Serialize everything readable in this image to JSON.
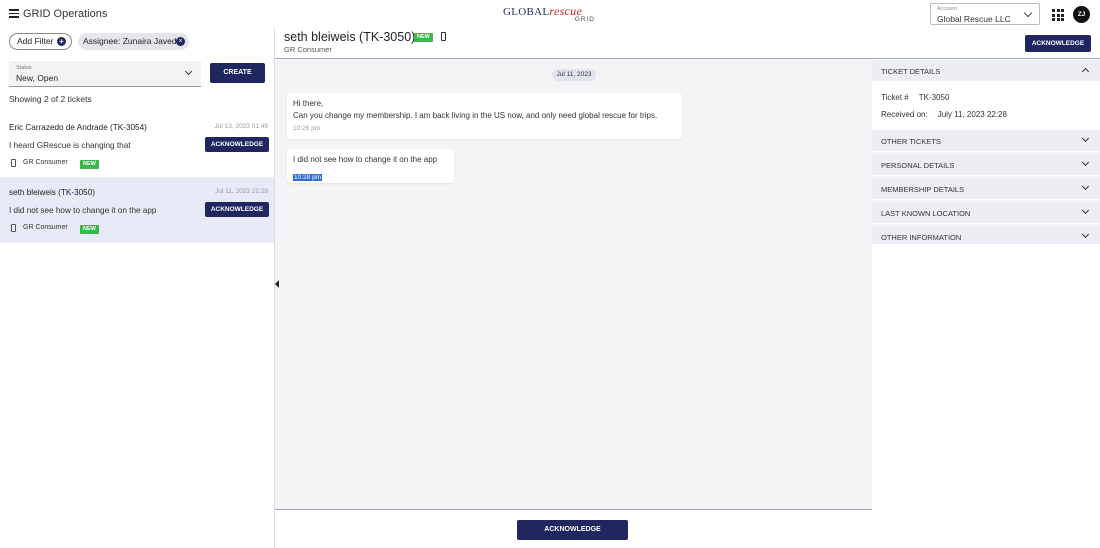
{
  "app": {
    "title": "GRID Operations"
  },
  "logo": {
    "main_left": "GLOBAL",
    "main_right": "rescue",
    "sub": "GRID"
  },
  "account": {
    "label": "Account",
    "value": "Global Rescue LLC"
  },
  "user": {
    "initials": "ZJ"
  },
  "filters": {
    "add_label": "Add Filter",
    "chip_label": "Assignee: Zunaira Javed"
  },
  "status_select": {
    "label": "Status",
    "value": "New, Open"
  },
  "create_label": "CREATE",
  "showing_text": "Showing 2 of 2 tickets",
  "tickets": [
    {
      "name": "Eric Carrazedo de Andrade (TK-3054)",
      "date": "Jul 13, 2023 01:49",
      "message": "I heard GRescue is changing that",
      "button": "ACKNOWLEDGE",
      "source": "GR Consumer",
      "badge": "NEW"
    },
    {
      "name": "seth bleiweis (TK-3050)",
      "date": "Jul 11, 2023 22:28",
      "message": "I did not see how to change it on the app",
      "button": "ACKNOWLEDGE",
      "source": "GR Consumer",
      "badge": "NEW"
    }
  ],
  "conversation": {
    "title": "seth bleiweis (TK-3050)",
    "badge": "NEW",
    "subtitle": "GR Consumer",
    "ack_top": "ACKNOWLEDGE",
    "date_pill": "Jul 11, 2023",
    "messages": [
      {
        "line1": "Hi there,",
        "line2": "Can you change my membership. I am back living in the US now, and only need global rescue for trips.",
        "time": "10:26 pm"
      },
      {
        "line1": "I did not see how to change it on the app",
        "time": "10:28 pm"
      }
    ],
    "ack_bottom": "ACKNOWLEDGE"
  },
  "sidebar": {
    "ticket_details": {
      "label": "TICKET DETAILS",
      "ticket_label": "Ticket #",
      "ticket_value": "TK-3050",
      "received_label": "Received on:",
      "received_value": "July 11, 2023 22:28"
    },
    "sections": [
      "OTHER TICKETS",
      "PERSONAL DETAILS",
      "MEMBERSHIP DETAILS",
      "LAST KNOWN LOCATION",
      "OTHER INFORMATION"
    ]
  },
  "colors": {
    "primary": "#1f2660",
    "new_badge": "#3cb54a",
    "selected_row": "#e6ebf7",
    "highlight": "#2e6fd3"
  }
}
